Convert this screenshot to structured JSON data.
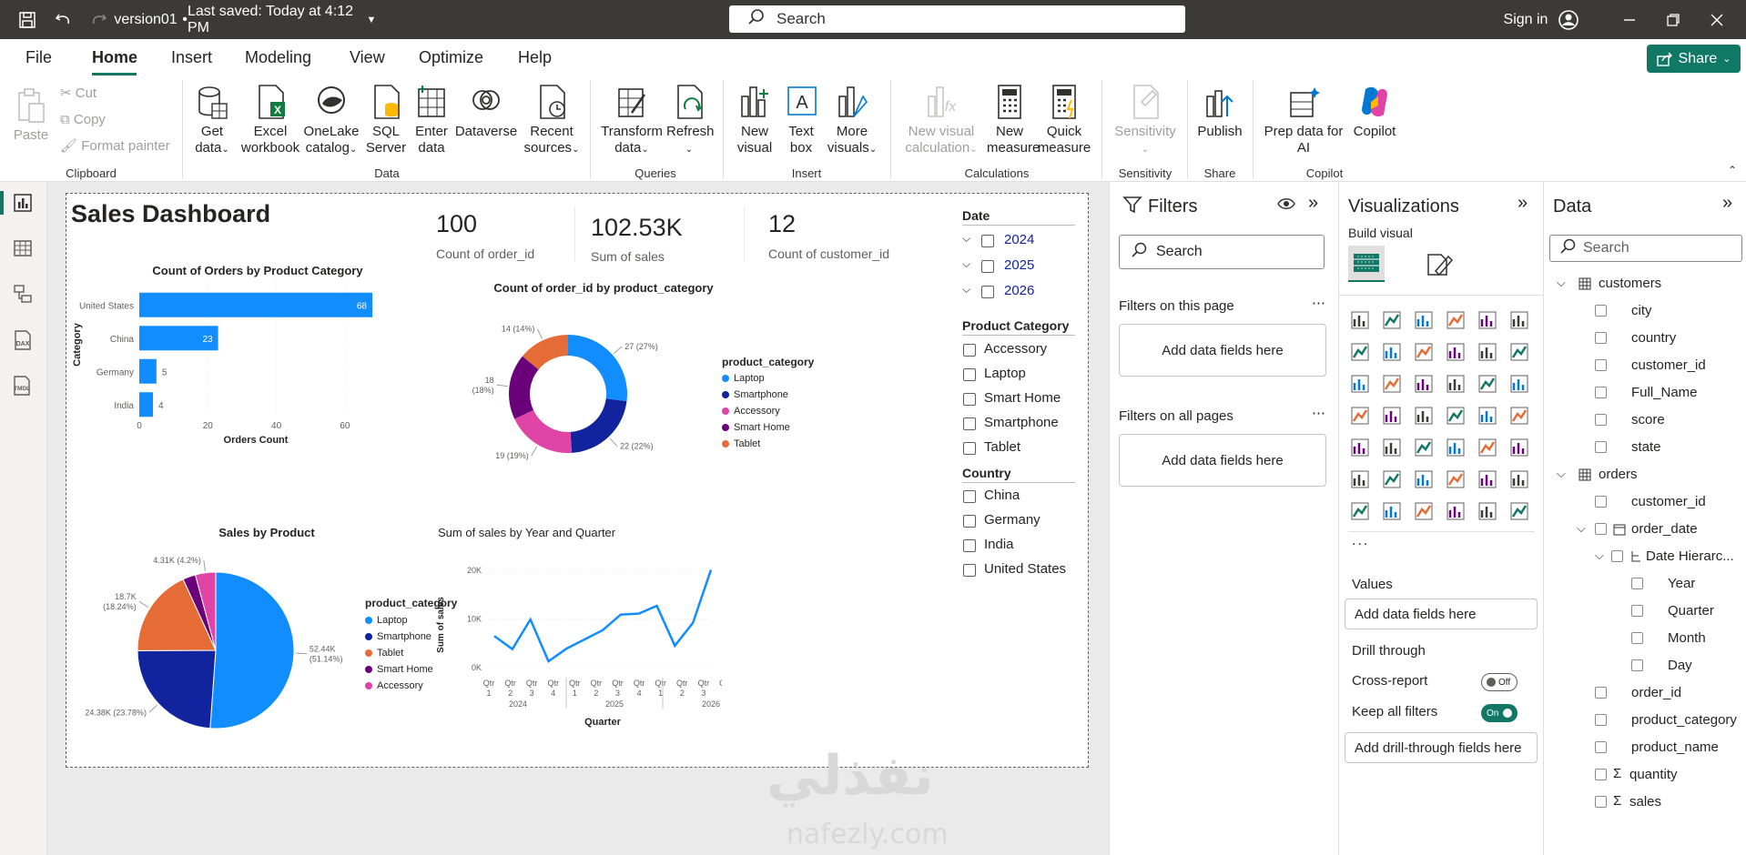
{
  "titlebar": {
    "file_name": "version01",
    "saved_status": "Last saved: Today at 4:12 PM",
    "search_placeholder": "Search",
    "sign_in": "Sign in"
  },
  "menu": {
    "file": "File",
    "home": "Home",
    "insert": "Insert",
    "modeling": "Modeling",
    "view": "View",
    "optimize": "Optimize",
    "help": "Help",
    "share": "Share"
  },
  "ribbon": {
    "paste": "Paste",
    "cut": "Cut",
    "copy": "Copy",
    "format_painter": "Format painter",
    "clipboard": "Clipboard",
    "get_data_1": "Get",
    "get_data_2": "data",
    "excel_1": "Excel",
    "excel_2": "workbook",
    "onelake_1": "OneLake",
    "onelake_2": "catalog",
    "sql_1": "SQL",
    "sql_2": "Server",
    "enter_1": "Enter",
    "enter_2": "data",
    "dataverse": "Dataverse",
    "recent_1": "Recent",
    "recent_2": "sources",
    "data_group": "Data",
    "transform_1": "Transform",
    "transform_2": "data",
    "refresh": "Refresh",
    "queries": "Queries",
    "new_visual_1": "New",
    "new_visual_2": "visual",
    "text_box_1": "Text",
    "text_box_2": "box",
    "more_visuals_1": "More",
    "more_visuals_2": "visuals",
    "insert_group": "Insert",
    "new_calc_1": "New visual",
    "new_calc_2": "calculation",
    "new_measure_1": "New",
    "new_measure_2": "measure",
    "quick_measure_1": "Quick",
    "quick_measure_2": "measure",
    "calculations": "Calculations",
    "sensitivity": "Sensitivity",
    "sensitivity_group": "Sensitivity",
    "publish": "Publish",
    "share_group": "Share",
    "prep_1": "Prep data for",
    "prep_2": "AI",
    "copilot": "Copilot",
    "copilot_group": "Copilot"
  },
  "report": {
    "title": "Sales Dashboard",
    "cards": [
      {
        "value": "100",
        "label": "Count of order_id"
      },
      {
        "value": "102.53K",
        "label": "Sum of sales"
      },
      {
        "value": "12",
        "label": "Count of customer_id"
      }
    ],
    "slicer_date": {
      "title": "Date",
      "items": [
        "2024",
        "2025",
        "2026"
      ]
    },
    "slicer_category": {
      "title": "Product Category",
      "items": [
        "Accessory",
        "Laptop",
        "Smart Home",
        "Smartphone",
        "Tablet"
      ]
    },
    "slicer_country": {
      "title": "Country",
      "items": [
        "China",
        "Germany",
        "India",
        "United States"
      ]
    }
  },
  "colors": {
    "blue": "#118dff",
    "navy": "#12239e",
    "orange": "#e66c37",
    "purple": "#6b007b",
    "pink": "#e044a7",
    "accent": "#117865"
  },
  "chart_data": [
    {
      "type": "bar",
      "title": "Count of Orders by Product Category",
      "xlabel": "Orders Count",
      "ylabel": "Category",
      "categories": [
        "United States",
        "China",
        "Germany",
        "India"
      ],
      "values": [
        68,
        23,
        5,
        4
      ],
      "xticks": [
        "0",
        "20",
        "40",
        "60"
      ],
      "xlim": [
        0,
        68
      ]
    },
    {
      "type": "pie",
      "subtype": "donut",
      "title": "Count of order_id by product_category",
      "legend_title": "product_category",
      "legend": [
        "Laptop",
        "Smartphone",
        "Accessory",
        "Smart Home",
        "Tablet"
      ],
      "slices": [
        {
          "name": "Laptop",
          "value": 27,
          "label": "27 (27%)",
          "color": "#118dff"
        },
        {
          "name": "Smartphone",
          "value": 22,
          "label": "22 (22%)",
          "color": "#12239e"
        },
        {
          "name": "Accessory",
          "value": 19,
          "label": "19 (19%)",
          "color": "#e044a7"
        },
        {
          "name": "Smart Home",
          "value": 18,
          "label": "18\n(18%)",
          "color": "#6b007b"
        },
        {
          "name": "Tablet",
          "value": 14,
          "label": "14 (14%)",
          "color": "#e66c37"
        }
      ]
    },
    {
      "type": "pie",
      "title": "Sales by Product",
      "legend_title": "product_category",
      "legend": [
        "Laptop",
        "Smartphone",
        "Tablet",
        "Smart Home",
        "Accessory"
      ],
      "slices": [
        {
          "name": "Laptop",
          "value": 52.44,
          "label": "52.44K\n(51.14%)",
          "color": "#118dff"
        },
        {
          "name": "Smartphone",
          "value": 24.38,
          "label": "24.38K (23.78%)",
          "color": "#12239e"
        },
        {
          "name": "Tablet",
          "value": 18.7,
          "label": "18.7K\n(18.24%)",
          "color": "#e66c37"
        },
        {
          "name": "Smart Home",
          "value": 2.7,
          "label": "",
          "color": "#6b007b"
        },
        {
          "name": "Accessory",
          "value": 4.31,
          "label": "4.31K (4.2%)",
          "color": "#e044a7"
        }
      ]
    },
    {
      "type": "line",
      "title": "Sum of sales by Year and Quarter",
      "xlabel": "Quarter",
      "ylabel": "Sum of sales",
      "quarters": [
        "Qtr 1",
        "Qtr 2",
        "Qtr 3",
        "Qtr 4",
        "Qtr 1",
        "Qtr 2",
        "Qtr 3",
        "Qtr 4",
        "Qtr 1",
        "Qtr 2",
        "Qtr 3",
        "Qtr 4"
      ],
      "years": [
        "2024",
        "2025",
        "2026"
      ],
      "points": [
        {
          "x": "2024-01",
          "y": 6500
        },
        {
          "x": "2024-02",
          "y": 3800
        },
        {
          "x": "2024-03",
          "y": 9900
        },
        {
          "x": "2024-04",
          "y": 1300
        },
        {
          "x": "2025-01",
          "y": 3900
        },
        {
          "x": "2025-02",
          "y": 5800
        },
        {
          "x": "2025-03",
          "y": 7700
        },
        {
          "x": "2025-04",
          "y": 10900
        },
        {
          "x": "2026-01",
          "y": 11100
        },
        {
          "x": "2026-02",
          "y": 12700
        },
        {
          "x": "2026-03",
          "y": 4500
        },
        {
          "x": "2026-04",
          "y": 9200
        },
        {
          "x": "2026-05",
          "y": 20100
        }
      ],
      "yticks": [
        "0K",
        "10K",
        "20K"
      ],
      "ylim": [
        0,
        20000
      ]
    }
  ],
  "filters": {
    "title": "Filters",
    "search": "Search",
    "on_page": "Filters on this page",
    "on_all": "Filters on all pages",
    "add_fields": "Add data fields here"
  },
  "visualizations": {
    "title": "Visualizations",
    "build": "Build visual",
    "values": "Values",
    "add_fields": "Add data fields here",
    "drill": "Drill through",
    "cross_report": "Cross-report",
    "cross_state": "Off",
    "keep_filters": "Keep all filters",
    "keep_state": "On",
    "add_drill": "Add drill-through fields here",
    "more": "..."
  },
  "data_pane": {
    "title": "Data",
    "search": "Search",
    "tables": [
      {
        "name": "customers",
        "fields": [
          "city",
          "country",
          "customer_id",
          "Full_Name",
          "score",
          "state"
        ]
      },
      {
        "name": "orders",
        "fields_a": [
          "customer_id"
        ],
        "date_field": "order_date",
        "hierarchy": "Date Hierarc...",
        "hier_levels": [
          "Year",
          "Quarter",
          "Month",
          "Day"
        ],
        "fields_b": [
          "order_id",
          "product_category",
          "product_name"
        ],
        "sigma_fields": [
          "quantity",
          "sales"
        ]
      }
    ]
  },
  "watermark": {
    "arabic": "نفذلي",
    "latin": "nafezly.com"
  }
}
